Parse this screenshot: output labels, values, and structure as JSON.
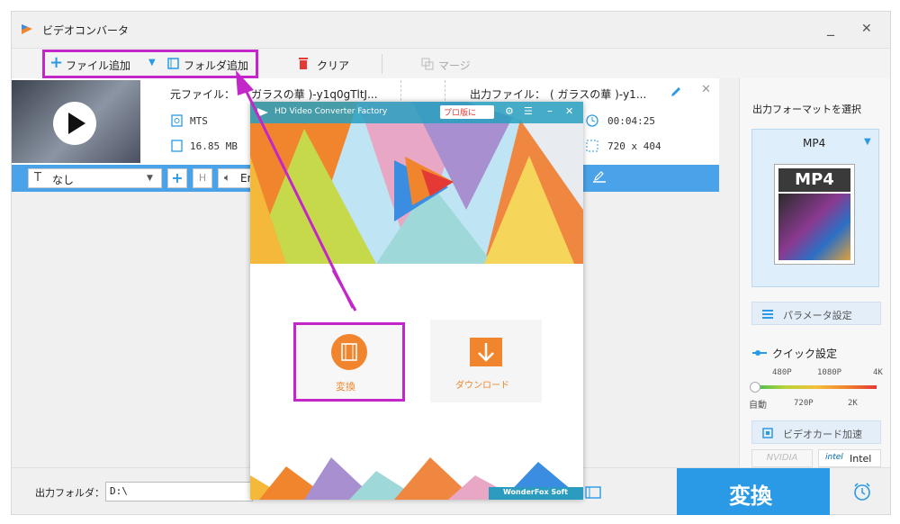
{
  "window": {
    "title": "ビデオコンバータ"
  },
  "toolbar": {
    "add_file": "ファイル追加",
    "add_folder": "フォルダ追加",
    "clear": "クリア",
    "merge": "マージ"
  },
  "file": {
    "source_label": "元ファイル：",
    "source_name": "ガラスの華 )-y1q0gTltJ...",
    "output_label": "出力ファイル：",
    "output_name": "( ガラスの華 )-y1...",
    "format": "MTS",
    "size": "16.85 MB",
    "duration": "00:04:25",
    "resolution": "720 x 404"
  },
  "editbar": {
    "subtitle_value": "なし",
    "audio_partial": "Er"
  },
  "right": {
    "header": "出力フォーマットを選択",
    "format": "MP4",
    "thumb_text": "MP4",
    "param": "パラメータ設定",
    "quick": "クイック設定",
    "labels_top": [
      "480P",
      "1080P",
      "4K"
    ],
    "labels_bottom": [
      "自動",
      "720P",
      "2K"
    ],
    "gpu": "ビデオカード加速",
    "nvidia": "NVIDIA",
    "intel": "Intel"
  },
  "bottom": {
    "folder_label": "出力フォルダ：",
    "folder_value": "D:\\",
    "convert": "変換"
  },
  "popup": {
    "app_name": "HD Video Converter Factory",
    "pro_badge": "プロ版に",
    "convert": "変換",
    "download": "ダウンロード",
    "brand": "WonderFox Soft"
  },
  "colors": {
    "accent": "#2a9ae6",
    "highlight": "#c326c9",
    "orange": "#f0852d",
    "red": "#e53935"
  }
}
